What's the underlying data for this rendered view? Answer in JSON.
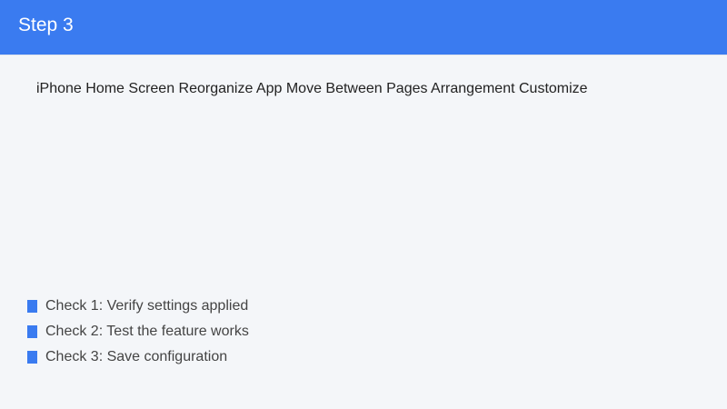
{
  "header": {
    "title": "Step 3"
  },
  "description": "iPhone Home Screen Reorganize App Move Between Pages Arrangement Customize",
  "checklist": {
    "items": [
      {
        "label": "Check 1: Verify settings applied"
      },
      {
        "label": "Check 2: Test the feature works"
      },
      {
        "label": "Check 3: Save configuration"
      }
    ]
  },
  "colors": {
    "accent": "#3a7bf0",
    "background": "#f4f6f9",
    "header_text": "#ffffff",
    "body_text": "#222222",
    "list_text": "#444444"
  },
  "icons": {
    "check_marker": "square-bullet-icon"
  }
}
